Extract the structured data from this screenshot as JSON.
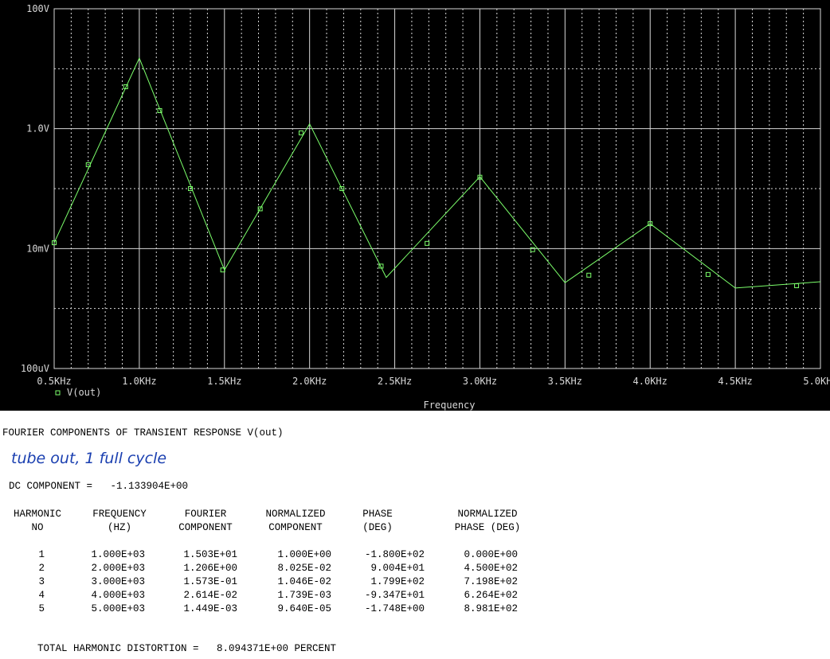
{
  "chart_data": {
    "type": "line",
    "xlabel": "Frequency",
    "x_ticks": [
      "0.5KHz",
      "1.0KHz",
      "1.5KHz",
      "2.0KHz",
      "2.5KHz",
      "3.0KHz",
      "3.5KHz",
      "4.0KHz",
      "4.5KHz",
      "5.0KHz"
    ],
    "y_ticks": [
      "100V",
      "1.0V",
      "10mV",
      "100uV"
    ],
    "xlim": [
      500,
      5000
    ],
    "ylim": [
      0.0001,
      100
    ],
    "yscale": "log",
    "grid": true,
    "legend_position": "bottom-left",
    "colors": {
      "background": "#000000",
      "trace": "#7cff6b",
      "grid": "#d8d8d8",
      "text": "#d8d8d8"
    },
    "series": [
      {
        "name": "V(out)",
        "points": [
          [
            500,
            0.0125
          ],
          [
            1000,
            15.0
          ],
          [
            1500,
            0.0044
          ],
          [
            2000,
            1.2
          ],
          [
            2450,
            0.0033
          ],
          [
            3000,
            0.158
          ],
          [
            3500,
            0.0027
          ],
          [
            4000,
            0.026
          ],
          [
            4500,
            0.0022
          ],
          [
            5000,
            0.0028
          ]
        ],
        "markers": [
          [
            500,
            0.0125
          ],
          [
            700,
            0.25
          ],
          [
            920,
            5.0
          ],
          [
            1120,
            2.0
          ],
          [
            1300,
            0.1
          ],
          [
            1490,
            0.0044
          ],
          [
            1710,
            0.046
          ],
          [
            1950,
            0.85
          ],
          [
            2190,
            0.1
          ],
          [
            2420,
            0.0051
          ],
          [
            2690,
            0.0122
          ],
          [
            3000,
            0.155
          ],
          [
            3310,
            0.0096
          ],
          [
            3640,
            0.0036
          ],
          [
            4000,
            0.026
          ],
          [
            4340,
            0.0037
          ],
          [
            4860,
            0.0024
          ]
        ]
      }
    ]
  },
  "report": {
    "heading": "FOURIER COMPONENTS OF TRANSIENT RESPONSE V(out)",
    "annotation": "tube out, 1 full cycle",
    "dc_line": "DC COMPONENT =   -1.133904E+00",
    "headers": [
      [
        "HARMONIC",
        "NO"
      ],
      [
        "FREQUENCY",
        "(HZ)"
      ],
      [
        "FOURIER",
        "COMPONENT"
      ],
      [
        "NORMALIZED",
        "COMPONENT"
      ],
      [
        "PHASE",
        "(DEG)"
      ],
      [
        "NORMALIZED",
        "PHASE (DEG)"
      ]
    ],
    "rows": [
      [
        "1",
        "1.000E+03",
        "1.503E+01",
        "1.000E+00",
        "-1.800E+02",
        "0.000E+00"
      ],
      [
        "2",
        "2.000E+03",
        "1.206E+00",
        "8.025E-02",
        "9.004E+01",
        "4.500E+02"
      ],
      [
        "3",
        "3.000E+03",
        "1.573E-01",
        "1.046E-02",
        "1.799E+02",
        "7.198E+02"
      ],
      [
        "4",
        "4.000E+03",
        "2.614E-02",
        "1.739E-03",
        "-9.347E+01",
        "6.264E+02"
      ],
      [
        "5",
        "5.000E+03",
        "1.449E-03",
        "9.640E-05",
        "-1.748E+00",
        "8.981E+02"
      ]
    ],
    "thd_line": "TOTAL HARMONIC DISTORTION =   8.094371E+00 PERCENT"
  }
}
